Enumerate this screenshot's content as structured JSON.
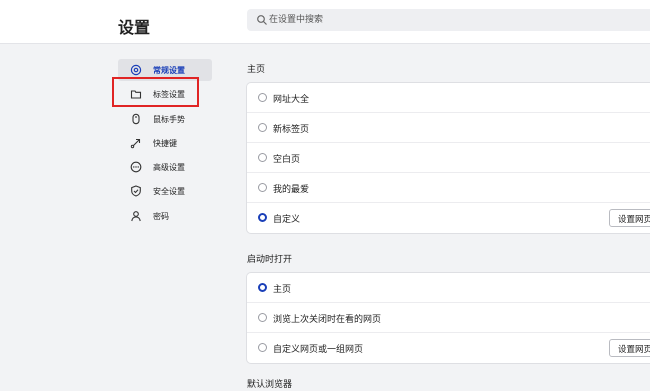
{
  "header": {
    "title": "设置",
    "search_placeholder": "在设置中搜索"
  },
  "sidebar": {
    "items": [
      {
        "label": "常规设置",
        "icon": "general-settings-icon",
        "active": true
      },
      {
        "label": "标签设置",
        "icon": "tab-icon",
        "active": false
      },
      {
        "label": "鼠标手势",
        "icon": "mouse-icon",
        "active": false
      },
      {
        "label": "快捷键",
        "icon": "shortcut-arrow-icon",
        "active": false
      },
      {
        "label": "高级设置",
        "icon": "more-icon",
        "active": false
      },
      {
        "label": "安全设置",
        "icon": "shield-icon",
        "active": false
      },
      {
        "label": "密码",
        "icon": "user-icon",
        "active": false
      }
    ]
  },
  "sections": {
    "homepage": {
      "title": "主页",
      "options": [
        {
          "label": "网址大全",
          "checked": false
        },
        {
          "label": "新标签页",
          "checked": false
        },
        {
          "label": "空白页",
          "checked": false
        },
        {
          "label": "我的最爱",
          "checked": false
        },
        {
          "label": "自定义",
          "checked": true,
          "button": "设置网页"
        }
      ]
    },
    "startup": {
      "title": "启动时打开",
      "options": [
        {
          "label": "主页",
          "checked": true
        },
        {
          "label": "浏览上次关闭时在看的网页",
          "checked": false
        },
        {
          "label": "自定义网页或一组网页",
          "checked": false,
          "button": "设置网页"
        }
      ]
    },
    "default_browser": {
      "title": "默认浏览器"
    }
  },
  "colors": {
    "accent": "#1a3fb8",
    "highlight_box": "#e02424",
    "background": "#f2f3f5"
  }
}
